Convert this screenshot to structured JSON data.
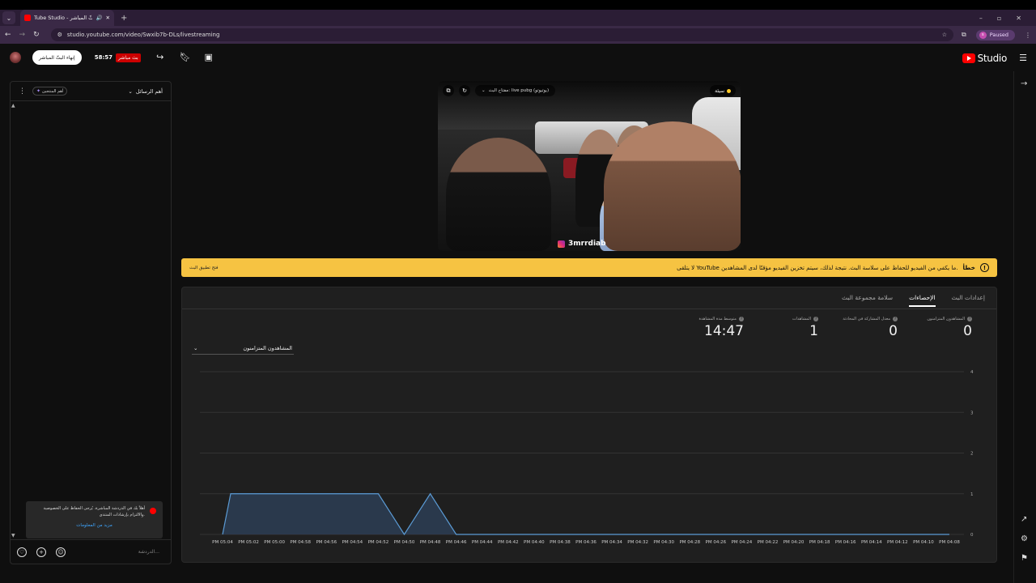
{
  "browser": {
    "tab_title": "Tube Studio - البثّ المباشر",
    "url": "studio.youtube.com/video/Swxib7b-DLs/livestreaming",
    "paused_label": "Paused"
  },
  "header": {
    "end_stream_label": "إنهاء البثّ المباشر",
    "timer": "58:57",
    "live_label": "بث مباشر",
    "studio_label": "Studio"
  },
  "chat": {
    "mode_label": "أهم الرسائل",
    "members_chip": "أهم المنتجين",
    "notice_text": "أهلاً بك في الدردشة المباشرة. يُرجى الحفاظ على الخصوصية والالتزام بإرشادات المنتدى.",
    "notice_link": "مزيد من المعلومات",
    "input_placeholder": "الدردشة..."
  },
  "preview": {
    "stream_key_label": "مفتاح البث: live pubg (يوتيوتو)",
    "health_label": "سيئة",
    "watermark": "3mrrdiab"
  },
  "banner": {
    "error_prefix": "خطأ",
    "message": "لا يتلقى YouTube ما يكفي من الفيديو للحفاظ على سلاسة البث. نتيجة لذلك، سيتم تخزين الفيديو مؤقتًا لدى المشاهدين.",
    "link": "فتح تطبيق البث"
  },
  "tabs": [
    "إعدادات البث",
    "الإحصاءات",
    "سلامة مجموعة البث"
  ],
  "metrics": [
    {
      "label": "المشاهدون المتزامنون",
      "value": "0"
    },
    {
      "label": "معدل المشاركة في المحادثة",
      "value": "0"
    },
    {
      "label": "المشاهدات",
      "value": "1"
    },
    {
      "label": "متوسط مدة المشاهدة",
      "value": "14:47"
    }
  ],
  "metric_dropdown": "المشاهدون المتزامنون",
  "chart_data": {
    "type": "area",
    "x": [
      "PM 05:04",
      "PM 05:02",
      "PM 05:00",
      "PM 04:58",
      "PM 04:56",
      "PM 04:54",
      "PM 04:52",
      "PM 04:50",
      "PM 04:48",
      "PM 04:46",
      "PM 04:44",
      "PM 04:42",
      "PM 04:40",
      "PM 04:38",
      "PM 04:36",
      "PM 04:34",
      "PM 04:32",
      "PM 04:30",
      "PM 04:28",
      "PM 04:26",
      "PM 04:24",
      "PM 04:22",
      "PM 04:20",
      "PM 04:18",
      "PM 04:16",
      "PM 04:14",
      "PM 04:12",
      "PM 04:10",
      "PM 04:08"
    ],
    "series": [
      {
        "values": [
          1,
          1,
          1,
          1,
          1,
          1,
          1,
          0,
          1,
          0,
          0,
          0,
          0,
          0,
          0,
          0,
          0,
          0,
          0,
          0,
          0,
          0,
          0,
          0,
          0,
          0,
          0,
          0,
          0
        ]
      }
    ],
    "y_ticks": [
      "0",
      "1",
      "2",
      "3",
      "4"
    ],
    "ylim": [
      0,
      4
    ],
    "grid": true,
    "colors": {
      "line": "#5b9bd5",
      "fill": "#2d3e55",
      "grid": "#333333"
    }
  }
}
